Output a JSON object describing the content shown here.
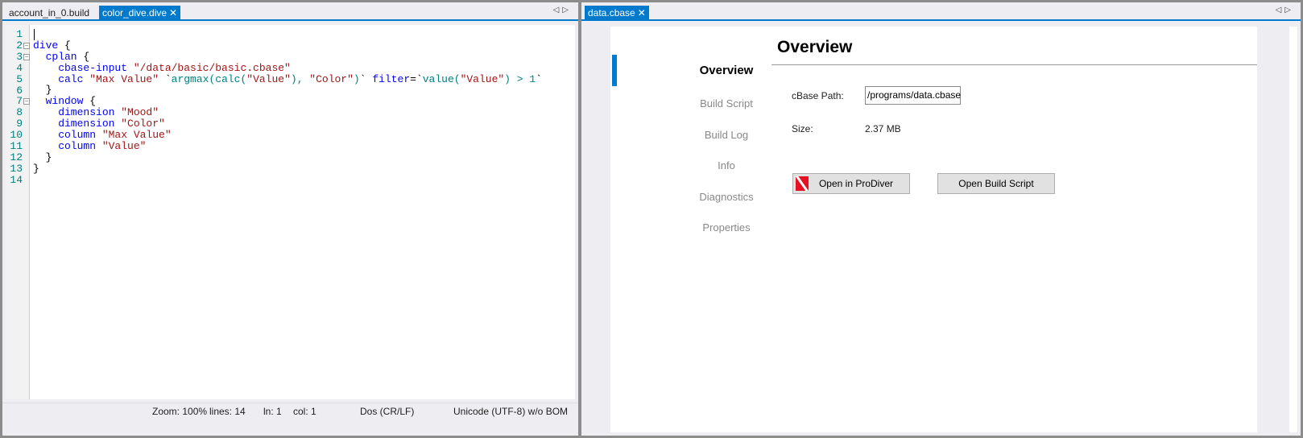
{
  "left_pane": {
    "tabs": [
      {
        "label": "account_in_0.build",
        "active": false
      },
      {
        "label": "color_dive.dive",
        "active": true
      }
    ],
    "code_lines": [
      [],
      [
        [
          "kw",
          "dive "
        ],
        [
          "tx",
          "{"
        ]
      ],
      [
        [
          "kw",
          "  cplan "
        ],
        [
          "tx",
          "{"
        ]
      ],
      [
        [
          "kw",
          "    cbase-input "
        ],
        [
          "st",
          "\"/data/basic/basic.cbase\""
        ]
      ],
      [
        [
          "kw",
          "    calc "
        ],
        [
          "st",
          "\"Max Value\" "
        ],
        [
          "tx",
          "`"
        ],
        [
          "fn",
          "argmax(calc("
        ],
        [
          "st",
          "\"Value\""
        ],
        [
          "fn",
          "), "
        ],
        [
          "st",
          "\"Color\""
        ],
        [
          "fn",
          ")"
        ],
        [
          "tx",
          "` "
        ],
        [
          "kw",
          "filter"
        ],
        [
          "tx",
          "=`"
        ],
        [
          "fn",
          "value("
        ],
        [
          "st",
          "\"Value\""
        ],
        [
          "fn",
          ") > 1"
        ],
        [
          "tx",
          "`"
        ]
      ],
      [
        [
          "tx",
          "  }"
        ]
      ],
      [
        [
          "kw",
          "  window "
        ],
        [
          "tx",
          "{"
        ]
      ],
      [
        [
          "kw",
          "    dimension "
        ],
        [
          "st",
          "\"Mood\""
        ]
      ],
      [
        [
          "kw",
          "    dimension "
        ],
        [
          "st",
          "\"Color\""
        ]
      ],
      [
        [
          "kw",
          "    column "
        ],
        [
          "st",
          "\"Max Value\""
        ]
      ],
      [
        [
          "kw",
          "    column "
        ],
        [
          "st",
          "\"Value\""
        ]
      ],
      [
        [
          "tx",
          "  }"
        ]
      ],
      [
        [
          "tx",
          "}"
        ]
      ],
      []
    ],
    "fold_lines": [
      2,
      3,
      7
    ],
    "status": {
      "zoom": "Zoom: 100%",
      "lines": "lines: 14",
      "ln": "ln: 1",
      "col": "col: 1",
      "eol": "Dos (CR/LF)",
      "encoding": "Unicode (UTF-8) w/o BOM"
    }
  },
  "right_pane": {
    "tab": {
      "label": "data.cbase",
      "active": true
    },
    "nav": [
      {
        "label": "Overview",
        "selected": true
      },
      {
        "label": "Build Script"
      },
      {
        "label": "Build Log"
      },
      {
        "label": "Info"
      },
      {
        "label": "Diagnostics"
      },
      {
        "label": "Properties"
      }
    ],
    "title": "Overview",
    "cbase_path_label": "cBase Path:",
    "cbase_path_value": "/programs/data.cbase",
    "size_label": "Size:",
    "size_value": "2.37 MB",
    "open_prodiver_label": "Open in ProDiver",
    "open_build_script_label": "Open Build Script"
  },
  "colors": {
    "accent": "#007acc",
    "keyword": "#0000ff",
    "string": "#a31515",
    "function": "#008080"
  }
}
